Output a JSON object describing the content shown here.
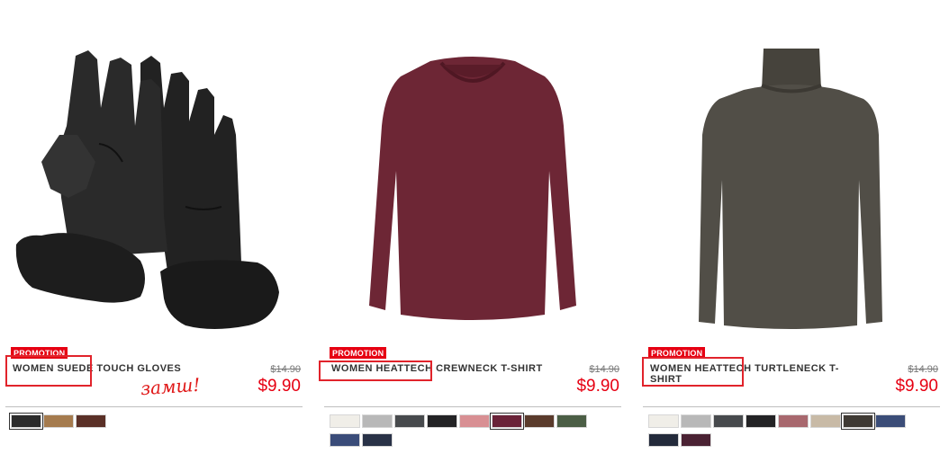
{
  "products": [
    {
      "promo": "PROMOTION",
      "name": "WOMEN SUEDE TOUCH GLOVES",
      "old_price": "$14.90",
      "price": "$9.90",
      "note": "замш!",
      "swatches": [
        {
          "color": "#2b2b2b",
          "selected": true
        },
        {
          "color": "#a57b4e",
          "selected": false
        },
        {
          "color": "#5a3027",
          "selected": false
        }
      ]
    },
    {
      "promo": "PROMOTION",
      "name": "WOMEN HEATTECH CREWNECK T-SHIRT",
      "old_price": "$14.90",
      "price": "$9.90",
      "swatches": [
        {
          "color": "#f0eee8",
          "selected": false
        },
        {
          "color": "#b8b8b8",
          "selected": false
        },
        {
          "color": "#474a4d",
          "selected": false
        },
        {
          "color": "#232325",
          "selected": false
        },
        {
          "color": "#d88f93",
          "selected": false
        },
        {
          "color": "#6a2238",
          "selected": true
        },
        {
          "color": "#5a3b2c",
          "selected": false
        },
        {
          "color": "#4b5e45",
          "selected": false
        },
        {
          "color": "#3a4c79",
          "selected": false
        },
        {
          "color": "#293247",
          "selected": false
        }
      ]
    },
    {
      "promo": "PROMOTION",
      "name": "WOMEN HEATTECH TURTLENECK T-SHIRT",
      "old_price": "$14.90",
      "price": "$9.90",
      "swatches": [
        {
          "color": "#f0eee8",
          "selected": false
        },
        {
          "color": "#b8b8b8",
          "selected": false
        },
        {
          "color": "#474a4d",
          "selected": false
        },
        {
          "color": "#232325",
          "selected": false
        },
        {
          "color": "#a8686e",
          "selected": false
        },
        {
          "color": "#c8baa6",
          "selected": false
        },
        {
          "color": "#3f3a34",
          "selected": true
        },
        {
          "color": "#3b4d78",
          "selected": false
        },
        {
          "color": "#232a3b",
          "selected": false
        },
        {
          "color": "#4a2233",
          "selected": false
        }
      ]
    }
  ]
}
